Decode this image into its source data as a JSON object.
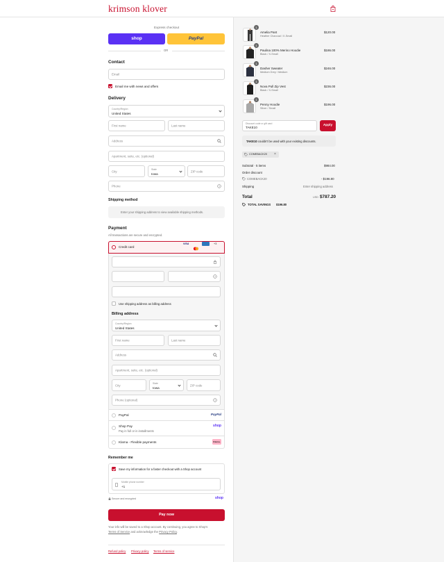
{
  "header": {
    "brand": "krimson klover"
  },
  "express": {
    "label": "Express checkout",
    "shop": "shop",
    "paypal": "PayPal",
    "or": "OR"
  },
  "contact": {
    "title": "Contact",
    "email_placeholder": "Email",
    "news_label": "Email me with news and offers"
  },
  "delivery": {
    "title": "Delivery",
    "country_label": "Country/Region",
    "country_value": "United States",
    "first_name": "First name",
    "last_name": "Last name",
    "address": "Address",
    "apartment": "Apartment, suite, etc. (optional)",
    "city": "City",
    "state_label": "State",
    "state_value": "Iowa",
    "zip": "ZIP code",
    "phone": "Phone"
  },
  "shipping": {
    "title": "Shipping method",
    "message": "Enter your shipping address to view available shipping methods."
  },
  "payment": {
    "title": "Payment",
    "subtitle": "All transactions are secure and encrypted.",
    "credit_card": "Credit card",
    "card_more": "+3",
    "billing_same": "Use shipping address as billing address",
    "billing_title": "Billing address",
    "billing_country_label": "Country/Region",
    "billing_country_value": "United States",
    "billing_first": "First name",
    "billing_last": "Last name",
    "billing_address": "Address",
    "billing_apartment": "Apartment, suite, etc. (optional)",
    "billing_city": "City",
    "billing_state_label": "State",
    "billing_state_value": "Iowa",
    "billing_zip": "ZIP code",
    "billing_phone": "Phone (optional)",
    "paypal": "PayPal",
    "paypal_logo": "PayPal",
    "shoppay": "Shop Pay",
    "shoppay_sub": "Pay in full or in installments",
    "shoppay_logo": "shop",
    "klarna": "Klarna - Flexible payments",
    "klarna_logo": "Klarna."
  },
  "remember": {
    "title": "Remember me",
    "save_label": "Save my information for a faster checkout with a Shop account",
    "phone_label": "Mobile phone number",
    "phone_value": "+1",
    "secure": "Secure and encrypted",
    "shop_logo": "shop"
  },
  "pay_now": "Pay now",
  "legal": {
    "text1": "Your info will be saved to a Shop account. By continuing, you agree to Shop's",
    "terms": "Terms of Service",
    "and": "and acknowledge the",
    "privacy": "Privacy Policy",
    "dot": "."
  },
  "footer": {
    "refund": "Refund policy",
    "privacy": "Privacy policy",
    "terms": "Terms of service"
  },
  "items": [
    {
      "name": "Amelia Pant",
      "variant": "Heather Charcoal / X-Small",
      "price": "$120.00",
      "qty": "1"
    },
    {
      "name": "Paulina 100% Merino Hoodie",
      "variant": "Black / X-Small",
      "price": "$186.00",
      "qty": "1"
    },
    {
      "name": "Dasher Sweater",
      "variant": "Medium Grey / Medium",
      "price": "$246.00",
      "qty": "1"
    },
    {
      "name": "Nova Pull Zip Vest",
      "variant": "Black / X-Small",
      "price": "$236.00",
      "qty": "1"
    },
    {
      "name": "Penny Hoodie",
      "variant": "Silver / Small",
      "price": "$196.00",
      "qty": "1"
    }
  ],
  "discount": {
    "label": "Discount code or gift card",
    "value": "TAKE10",
    "apply": "Apply",
    "error_code": "TAKE10",
    "error_text": "couldn't be used with your existing discounts.",
    "chip": "COMEBACK20"
  },
  "summary": {
    "subtotal_label": "Subtotal · 5 items",
    "subtotal": "$984.00",
    "order_discount": "Order discount",
    "discount_code": "COMEBACK20",
    "discount_amount": "- $196.80",
    "shipping_label": "Shipping",
    "shipping_value": "Enter shipping address",
    "total_label": "Total",
    "currency": "USD",
    "total": "$787.20",
    "savings_label": "TOTAL SAVINGS",
    "savings": "$196.80"
  },
  "colors": {
    "accent": "#c8102e",
    "shop": "#5a31f4",
    "paypal": "#ffc439"
  }
}
